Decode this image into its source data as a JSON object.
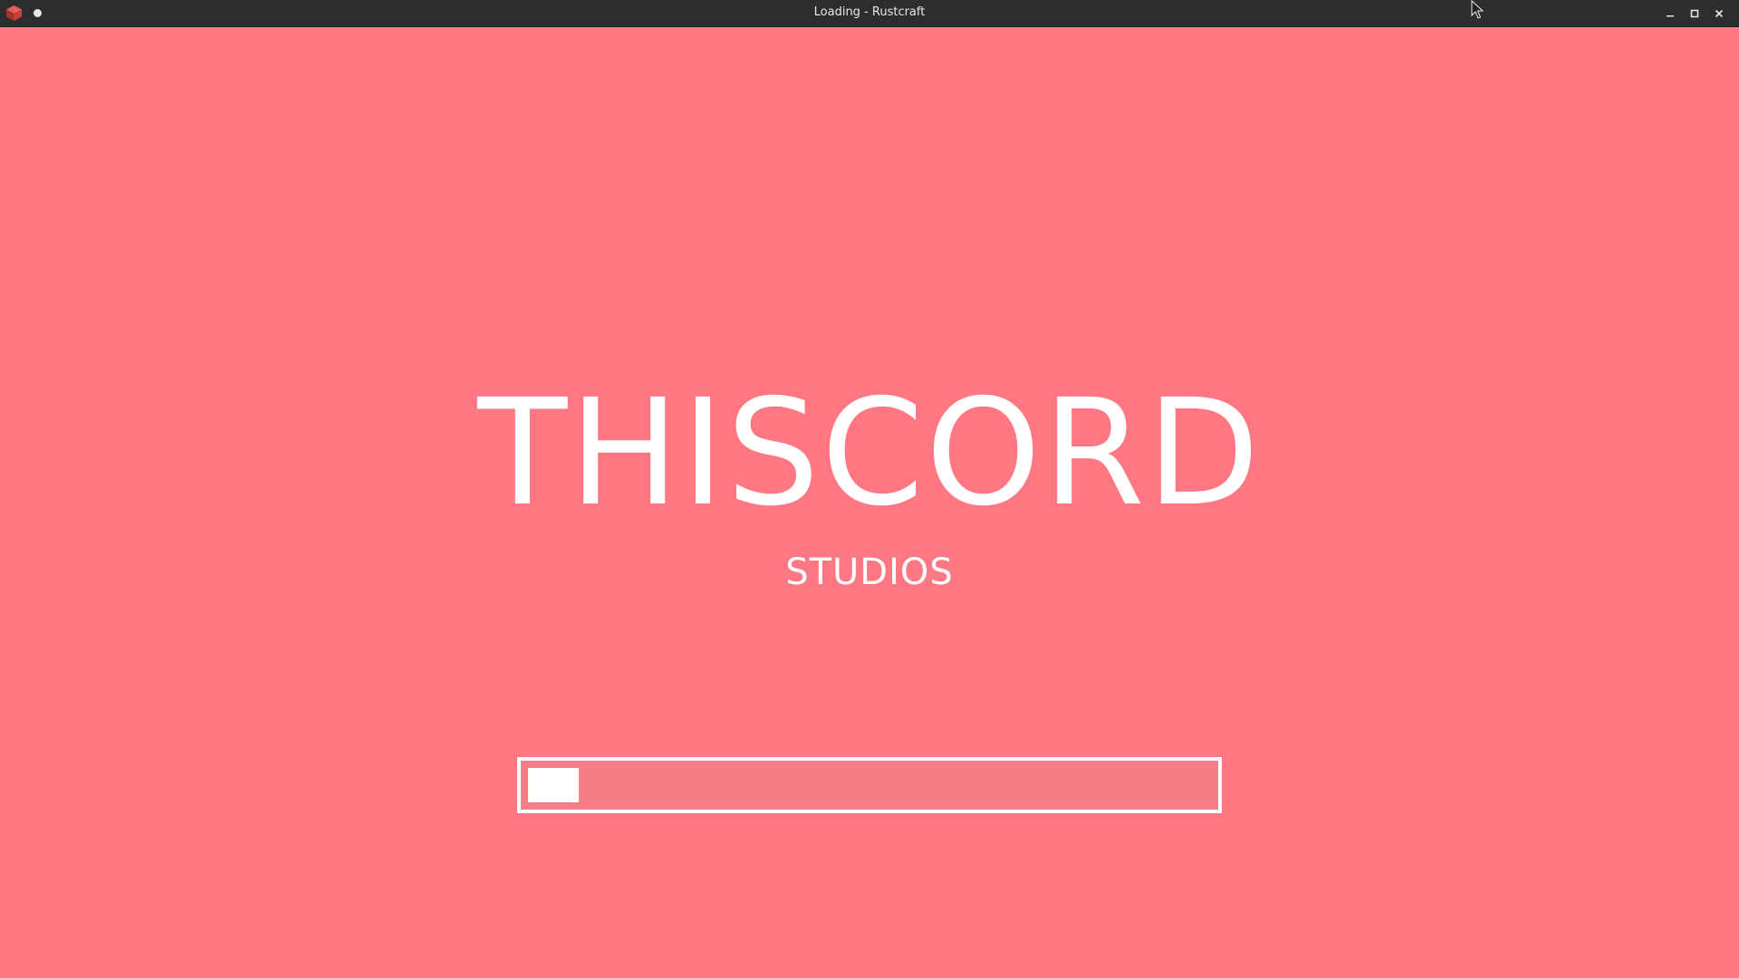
{
  "window": {
    "title": "Loading - Rustcraft",
    "app_icon": "cube-icon",
    "controls": [
      "minimize-icon",
      "maximize-icon",
      "close-icon"
    ]
  },
  "splash": {
    "title": "THISCORD",
    "subtitle": "STUDIOS",
    "background_color": "#ff7782",
    "text_color": "#ffffff"
  },
  "loading": {
    "progress_fraction": 0.074
  }
}
